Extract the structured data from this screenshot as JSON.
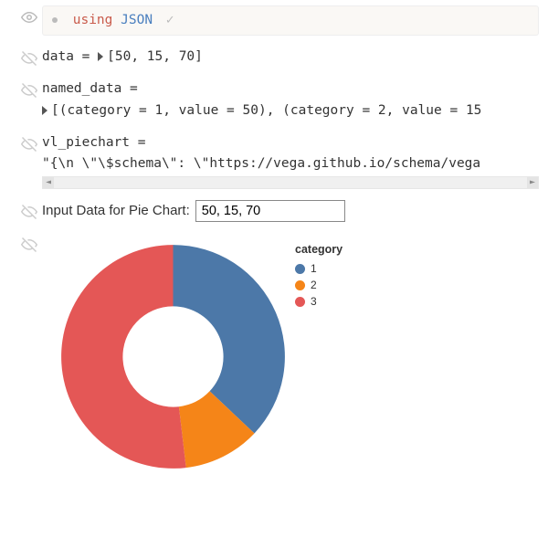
{
  "cells": {
    "using": {
      "keyword": "using",
      "identifier": "JSON",
      "status": "✓"
    },
    "data": {
      "var": "data",
      "equals": " = ",
      "value": "[50, 15, 70]"
    },
    "named_data": {
      "var": "named_data",
      "equals": " =",
      "value": "[(category = 1, value = 50), (category = 2, value = 15"
    },
    "vl_piechart": {
      "var": "vl_piechart",
      "equals": " =",
      "value": "\"{\\n  \\\"\\$schema\\\": \\\"https://vega.github.io/schema/vega"
    },
    "input": {
      "label": "Input Data for Pie Chart:",
      "value": "50, 15, 70"
    }
  },
  "legend": {
    "title": "category",
    "items": [
      {
        "label": "1",
        "color": "#4c78a8"
      },
      {
        "label": "2",
        "color": "#f58518"
      },
      {
        "label": "3",
        "color": "#e45756"
      }
    ]
  },
  "scroll": {
    "left": "◄",
    "right": "►"
  },
  "chart_data": {
    "type": "pie",
    "title": "",
    "inner_radius_ratio": 0.45,
    "categories": [
      "1",
      "2",
      "3"
    ],
    "values": [
      50,
      15,
      70
    ],
    "colors": [
      "#4c78a8",
      "#f58518",
      "#e45756"
    ],
    "legend_title": "category",
    "legend_position": "right"
  }
}
